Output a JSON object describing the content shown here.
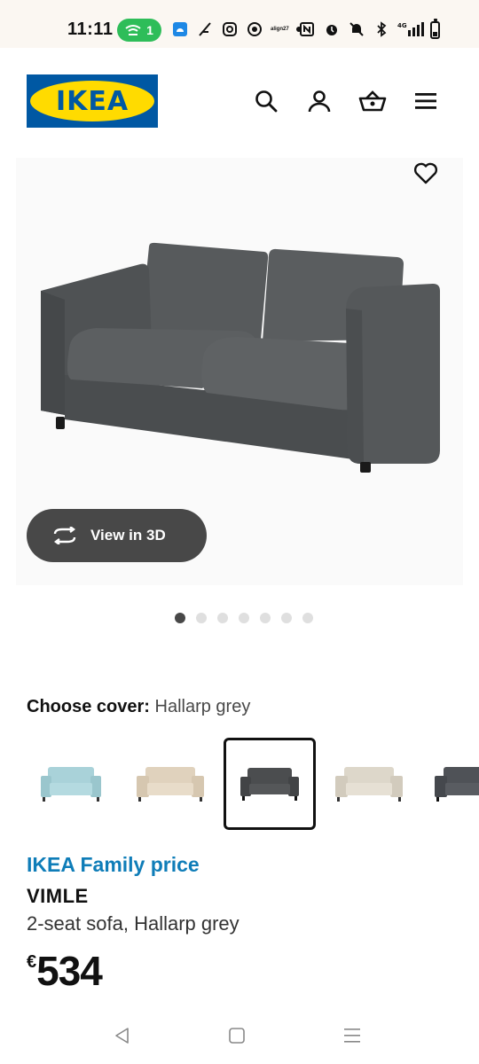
{
  "status_bar": {
    "time": "11:11",
    "wifi_count": "1",
    "align_label": "align27",
    "network": "4G"
  },
  "header": {
    "logo_text": "IKEA",
    "icons": [
      "search-icon",
      "account-icon",
      "basket-icon",
      "menu-icon"
    ]
  },
  "gallery": {
    "view_3d_label": "View in 3D",
    "image_count": 7,
    "active_index": 0
  },
  "cover": {
    "label": "Choose cover:",
    "value": "Hallarp grey",
    "swatches": [
      {
        "name": "light-blue",
        "color": "#a9d2d9"
      },
      {
        "name": "beige",
        "color": "#e0d2bd"
      },
      {
        "name": "hallarp-grey",
        "color": "#4b4d4f"
      },
      {
        "name": "off-white",
        "color": "#ddd7ca"
      },
      {
        "name": "dark-grey",
        "color": "#4f5257"
      }
    ],
    "selected_index": 2
  },
  "product": {
    "family_price_label": "IKEA Family price",
    "name": "VIMLE",
    "description": "2-seat sofa, Hallarp grey",
    "currency": "€",
    "price": "534"
  },
  "colors": {
    "brand_blue": "#0058a3",
    "brand_yellow": "#ffdb00",
    "family_blue": "#0f7db8",
    "button_dark": "#484848"
  }
}
